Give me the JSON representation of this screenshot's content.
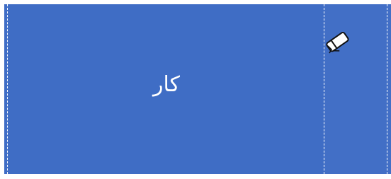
{
  "segment": {
    "label": "کار"
  },
  "cursor": {
    "icon": "eraser-icon"
  },
  "colors": {
    "bar": "#3f6dc5",
    "guide": "#ffffff",
    "label": "#ffffff"
  }
}
